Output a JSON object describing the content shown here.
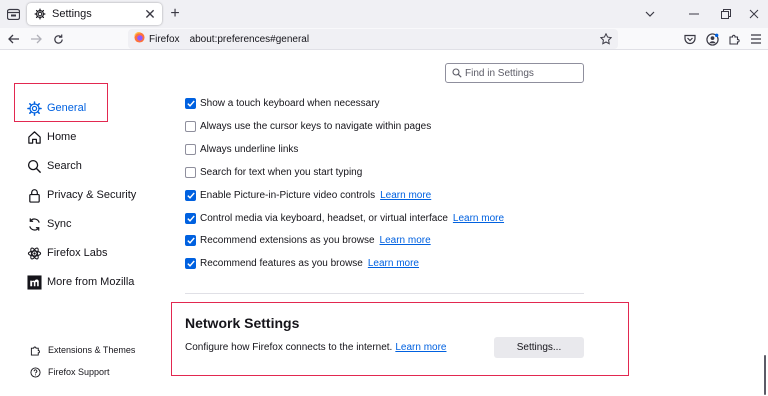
{
  "tab": {
    "title": "Settings",
    "close": "✕"
  },
  "newtab": {
    "label": "+"
  },
  "urlbar": {
    "identity": "Firefox",
    "url": "about:preferences#general"
  },
  "search": {
    "placeholder": "Find in Settings"
  },
  "sidebar": {
    "items": [
      {
        "label": "General",
        "icon": "gear-icon",
        "selected": true
      },
      {
        "label": "Home",
        "icon": "home-icon"
      },
      {
        "label": "Search",
        "icon": "search-icon"
      },
      {
        "label": "Privacy & Security",
        "icon": "lock-icon"
      },
      {
        "label": "Sync",
        "icon": "sync-icon"
      },
      {
        "label": "Firefox Labs",
        "icon": "atom-icon"
      },
      {
        "label": "More from Mozilla",
        "icon": "mozilla-icon"
      }
    ],
    "footer": [
      {
        "label": "Extensions & Themes",
        "icon": "puzzle-icon"
      },
      {
        "label": "Firefox Support",
        "icon": "help-icon"
      }
    ]
  },
  "options": [
    {
      "label": "Show a touch keyboard when necessary",
      "checked": true
    },
    {
      "label": "Always use the cursor keys to navigate within pages",
      "checked": false
    },
    {
      "label": "Always underline links",
      "checked": false
    },
    {
      "label": "Search for text when you start typing",
      "checked": false
    },
    {
      "label": "Enable Picture-in-Picture video controls",
      "checked": true,
      "link": "Learn more"
    },
    {
      "label": "Control media via keyboard, headset, or virtual interface",
      "checked": true,
      "link": "Learn more"
    },
    {
      "label": "Recommend extensions as you browse",
      "checked": true,
      "link": "Learn more"
    },
    {
      "label": "Recommend features as you browse",
      "checked": true,
      "link": "Learn more"
    }
  ],
  "network": {
    "title": "Network Settings",
    "description": "Configure how Firefox connects to the internet.",
    "link": "Learn more",
    "button": "Settings..."
  },
  "colors": {
    "accent": "#0061e0",
    "highlight": "#e22850"
  }
}
